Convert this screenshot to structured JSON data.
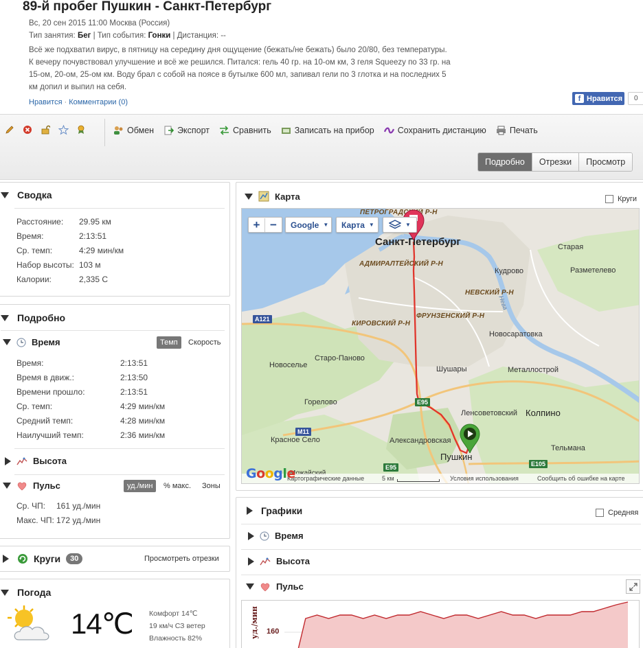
{
  "activity": {
    "title": "89-й пробег Пушкин - Санкт-Петербург",
    "date": "Вс, 20 сен 2015 11:00 Москва (Россия)",
    "type_label": "Тип занятия:",
    "type_value": "Бег",
    "event_label": "Тип события:",
    "event_value": "Гонки",
    "distance_label": "Дистанция:",
    "distance_value": "--",
    "description_lines": [
      "Всё же подхватил вирус, в пятницу на середину дня ощущение (бежать/не бежать) было 20/80, без температуры.",
      "К вечеру почувствовал улучшение и всё же решился. Питался: гель 40 гр. на 10-ом км, 3 геля Squeezy по 33 гр. на",
      "15-ом, 20-ом, 25-ом км. Воду брал с собой на поясе в бутылке 600 мл, запивал гели по 3 глотка и на последних 5",
      "км допил и выпил на себя."
    ],
    "like_link": "Нравится",
    "comments_link": "Комментарии (0)",
    "fb_like": "Нравится",
    "fb_count": "0"
  },
  "toolbar": {
    "actions": [
      "Обмен",
      "Экспорт",
      "Сравнить",
      "Записать на прибор",
      "Сохранить дистанцию",
      "Печать"
    ],
    "views": [
      "Подробно",
      "Отрезки",
      "Просмотр"
    ],
    "active_view": "Подробно"
  },
  "summary": {
    "title": "Сводка",
    "rows": [
      {
        "label": "Расстояние:",
        "value": "29.95 км"
      },
      {
        "label": "Время:",
        "value": "2:13:51"
      },
      {
        "label": "Ср. темп:",
        "value": "4:29 мин/км"
      },
      {
        "label": "Набор высоты:",
        "value": "103 м"
      },
      {
        "label": "Калории:",
        "value": "2,335 С"
      }
    ]
  },
  "details": {
    "title": "Подробно",
    "time": {
      "title": "Время",
      "toggle_on": "Темп",
      "toggle_off": "Скорость",
      "rows": [
        {
          "label": "Время:",
          "value": "2:13:51"
        },
        {
          "label": "Время в движ.:",
          "value": "2:13:50"
        },
        {
          "label": "Времени прошло:",
          "value": "2:13:51"
        },
        {
          "label": "Ср. темп:",
          "value": "4:29 мин/км"
        },
        {
          "label": "Средний темп:",
          "value": "4:28 мин/км"
        },
        {
          "label": "Наилучший темп:",
          "value": "2:36 мин/км"
        }
      ]
    },
    "elevation_title": "Высота",
    "hr": {
      "title": "Пульс",
      "toggles": [
        "уд./мин",
        "% макс.",
        "Зоны"
      ],
      "rows": [
        {
          "label": "Ср. ЧП:",
          "value": "161 уд./мин"
        },
        {
          "label": "Макс. ЧП:",
          "value": "172 уд./мин"
        }
      ]
    }
  },
  "laps": {
    "title": "Круги",
    "count": "30",
    "link": "Просмотреть отрезки"
  },
  "weather": {
    "title": "Погода",
    "temp": "14℃",
    "lines": [
      "Комфорт 14℃",
      "19 км/ч СЗ ветер",
      "Влажность 82%"
    ]
  },
  "map": {
    "title": "Карта",
    "laps_checkbox": "Круги",
    "controls": {
      "provider": "Google",
      "type": "Карта"
    },
    "labels": {
      "spb": "Санкт-Петербург",
      "petrograd": "ПЕТРОГРАДСКИЙ Р-Н",
      "admiralty": "АДМИРАЛТЕЙСКИЙ Р-Н",
      "nevsky": "НЕВСКИЙ Р-Н",
      "frunze": "ФРУНЗЕНСКИЙ Р-Н",
      "kirov": "КИРОВСКИЙ Р-Н",
      "staraya": "Старая",
      "kudrovo": "Кудрово",
      "razmetelevo": "Разметелево",
      "novosaratovka": "Новосаратовка",
      "neva": "Нева",
      "staropanovo": "Старо-Паново",
      "novoselye": "Новоселье",
      "shushary": "Шушары",
      "metallostroy": "Металлострой",
      "gorelovo": "Горелово",
      "lensovet": "Ленсоветовский",
      "kolpino": "Колпино",
      "krasnoe": "Красное Село",
      "aleksandr": "Александровская",
      "pushkin": "Пушкин",
      "telmana": "Тельмана",
      "mozh": "Можайский"
    },
    "shields": {
      "a121": "A121",
      "e95a": "E95",
      "e95b": "E95",
      "m11": "M11",
      "e105": "E105"
    },
    "footer": {
      "logo": "Google",
      "data": "Картографические данные",
      "scale": "5 км",
      "terms": "Условия использования",
      "report": "Сообщить об ошибке на карте"
    }
  },
  "charts": {
    "title": "Графики",
    "avg_checkbox": "Средняя",
    "items": [
      "Время",
      "Высота",
      "Пульс"
    ],
    "hr_axis_label": "уд./мин",
    "hr_tick": "160"
  },
  "chart_data": {
    "type": "area",
    "ylabel": "уд./мин",
    "y_ticks": [
      160
    ],
    "series": [
      {
        "values": [
          150,
          164,
          165,
          164,
          165,
          165,
          164,
          165,
          164,
          165,
          165,
          166,
          165,
          164,
          165,
          165,
          164,
          165,
          166,
          165,
          165,
          164,
          165,
          165,
          165,
          166,
          166,
          167,
          168,
          171
        ]
      }
    ]
  },
  "colors": {
    "accent": "#2a66a8",
    "route": "#e0352c",
    "fb": "#4267b2",
    "hr_fill": "#f4c9c9",
    "hr_line": "#c0282d"
  }
}
